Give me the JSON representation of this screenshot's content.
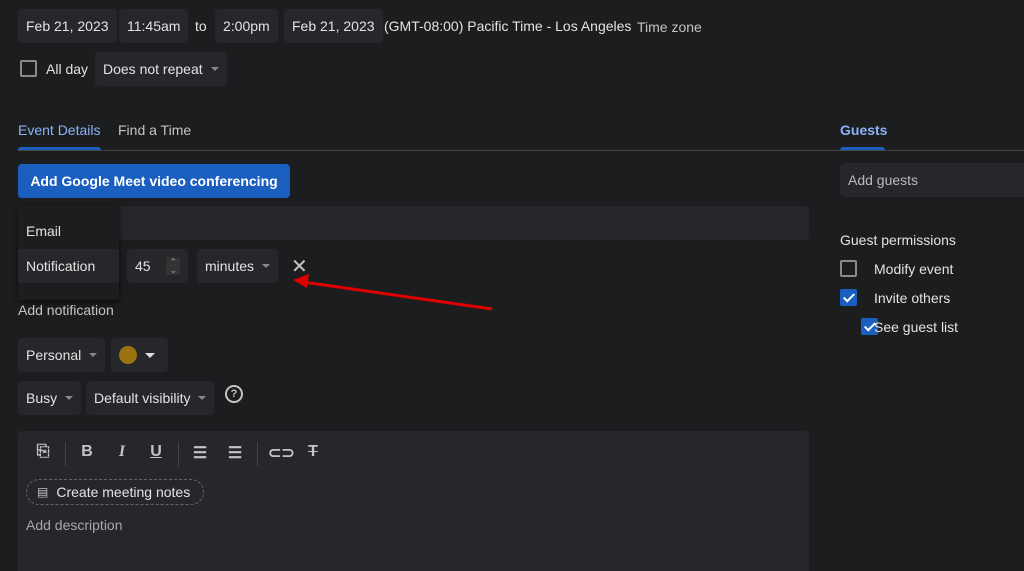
{
  "datetime": {
    "start_date": "Feb 21, 2023",
    "start_time": "11:45am",
    "to": "to",
    "end_time": "2:00pm",
    "end_date": "Feb 21, 2023",
    "tz": "(GMT-08:00) Pacific Time - Los Angeles",
    "tz_button": "Time zone"
  },
  "allday": {
    "label": "All day",
    "checked": false
  },
  "repeat": "Does not repeat",
  "tabs": [
    {
      "label": "Event Details",
      "active": true
    },
    {
      "label": "Find a Time",
      "active": false
    }
  ],
  "meet_button": "Add Google Meet video conferencing",
  "notif_menu": [
    "Email",
    "Notification"
  ],
  "notif": {
    "value": "45",
    "unit": "minutes"
  },
  "add_notification": "Add notification",
  "calendar": "Personal",
  "calendar_color": "#9a7310",
  "busy": "Busy",
  "visibility": "Default visibility",
  "meeting_notes": "Create meeting notes",
  "description_placeholder": "Add description",
  "guests": {
    "title": "Guests",
    "placeholder": "Add guests",
    "perm_title": "Guest permissions",
    "perms": [
      {
        "label": "Modify event",
        "checked": false
      },
      {
        "label": "Invite others",
        "checked": true
      },
      {
        "label": "See guest list",
        "checked": true
      }
    ]
  },
  "colors": {
    "accent": "#8ab4f8",
    "button": "#1a5fbf",
    "arrow": "#e00000"
  }
}
